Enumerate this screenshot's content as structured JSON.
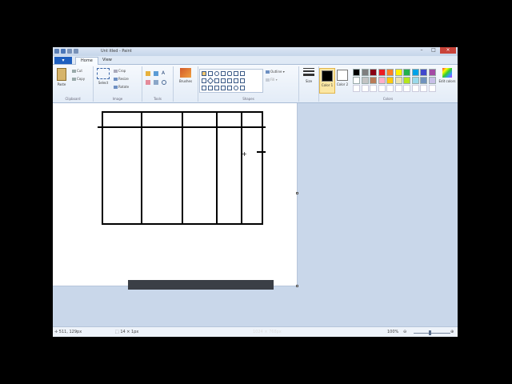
{
  "titlebar": {
    "title": "Unt itled - Paint"
  },
  "tabs": {
    "paint_menu": "▾",
    "home": "Home",
    "view": "View"
  },
  "ribbon": {
    "clipboard": {
      "paste": "Paste",
      "cut": "Cut",
      "copy": "Copy",
      "label": "Clipboard"
    },
    "image": {
      "select": "Select",
      "crop": "Crop",
      "resize": "Resize",
      "rotate": "Rotate",
      "label": "Image"
    },
    "tools": {
      "label": "Tools"
    },
    "brushes": {
      "label": "Brushes"
    },
    "shapes": {
      "outline": "Outline",
      "fill": "Fill",
      "label": "Shapes"
    },
    "size": {
      "label": "Size"
    },
    "colors": {
      "color1": "Color 1",
      "color2": "Color 2",
      "edit": "Edit colors",
      "label": "Colors",
      "palette_row1": [
        "#000000",
        "#7f7f7f",
        "#880015",
        "#ed1c24",
        "#ff7f27",
        "#fff200",
        "#22b14c",
        "#00a2e8",
        "#3f48cc",
        "#a349a4"
      ],
      "palette_row2": [
        "#ffffff",
        "#c3c3c3",
        "#b97a57",
        "#ffaec9",
        "#ffc90e",
        "#efe4b0",
        "#b5e61d",
        "#99d9ea",
        "#7092be",
        "#c8bfe7"
      ],
      "color1_value": "#000000",
      "color2_value": "#ffffff"
    }
  },
  "status": {
    "cursor_pos": "511, 129px",
    "selection_size": "14 × 1px",
    "canvas_size": "1024 × 768px",
    "zoom": "100%"
  }
}
